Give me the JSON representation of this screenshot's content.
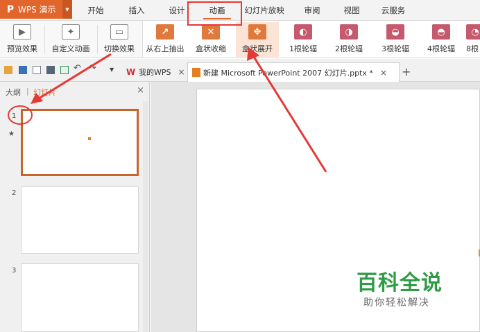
{
  "app": {
    "title": "WPS 演示",
    "logo": "P",
    "accent": "#e2662c"
  },
  "menu": {
    "tabs": [
      "开始",
      "插入",
      "设计",
      "动画",
      "幻灯片放映",
      "审阅",
      "视图",
      "云服务"
    ],
    "active": "动画"
  },
  "ribbon": {
    "buttons": [
      {
        "label": "预览效果",
        "icon": "preview-icon"
      },
      {
        "label": "自定义动画",
        "icon": "custom-animation-icon"
      },
      {
        "label": "切换效果",
        "icon": "transition-icon"
      },
      {
        "label": "从右上抽出",
        "icon": "fly-out-icon"
      },
      {
        "label": "盒状收缩",
        "icon": "box-shrink-icon"
      },
      {
        "label": "盒状展开",
        "icon": "box-expand-icon"
      },
      {
        "label": "1根轮辐",
        "icon": "spoke1-icon"
      },
      {
        "label": "2根轮辐",
        "icon": "spoke2-icon"
      },
      {
        "label": "3根轮辐",
        "icon": "spoke3-icon"
      },
      {
        "label": "4根轮辐",
        "icon": "spoke4-icon"
      },
      {
        "label": "8根",
        "icon": "spoke8-icon"
      }
    ]
  },
  "doc_tabs": [
    {
      "label": "我的WPS",
      "close": "×"
    },
    {
      "label": "新建 Microsoft PowerPoint 2007 幻灯片.pptx *",
      "close": "×"
    }
  ],
  "left_panel": {
    "tab_outline": "大纲",
    "separator": "|",
    "tab_slides": "幻灯片",
    "close": "×",
    "slides": [
      "1",
      "2",
      "3"
    ],
    "slide1_marker": "★"
  },
  "watermark": {
    "title": "百科全说",
    "subtitle": "助你轻松解决"
  },
  "colors": {
    "highlight_red": "#e53935",
    "watermark_green": "#2e9b45"
  }
}
